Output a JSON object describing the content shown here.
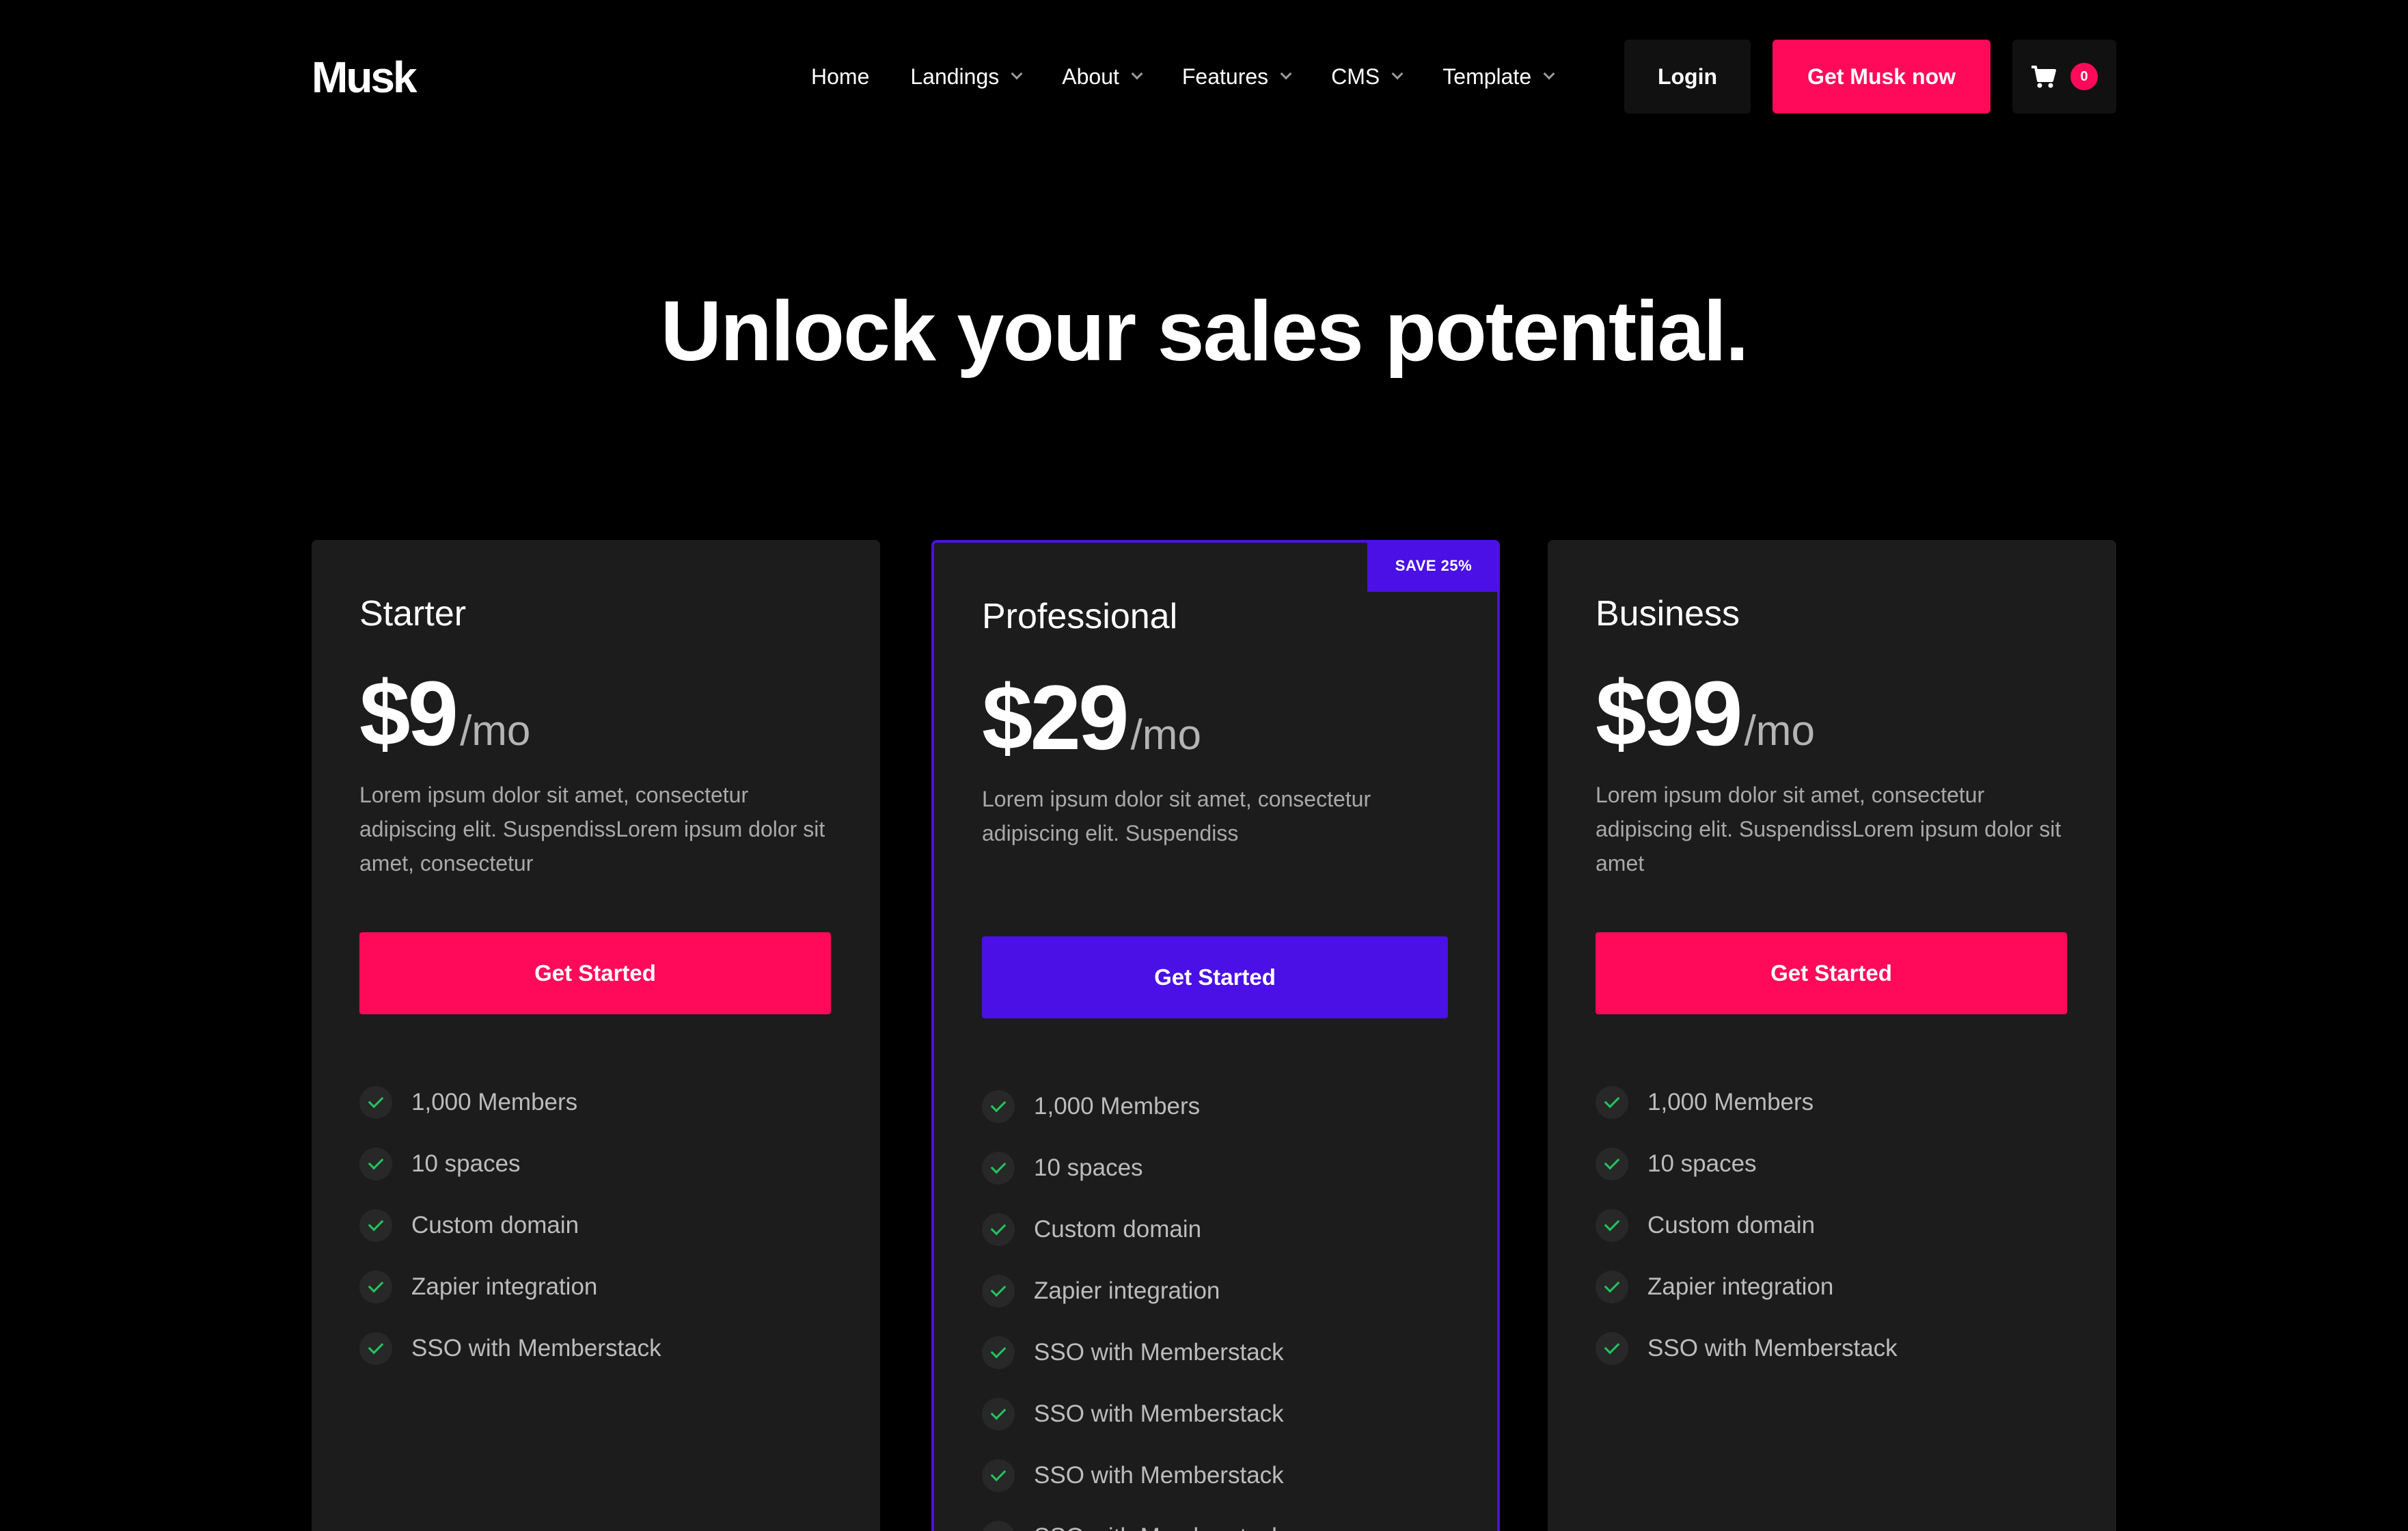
{
  "nav": {
    "logo": "Musk",
    "menu": [
      {
        "label": "Home",
        "dropdown": false
      },
      {
        "label": "Landings",
        "dropdown": true
      },
      {
        "label": "About",
        "dropdown": true
      },
      {
        "label": "Features",
        "dropdown": true
      },
      {
        "label": "CMS",
        "dropdown": true
      },
      {
        "label": "Template",
        "dropdown": true
      }
    ],
    "login_label": "Login",
    "cta_label": "Get Musk now",
    "cart_count": "0"
  },
  "hero": {
    "title": "Unlock your sales potential."
  },
  "colors": {
    "accent_pink": "#ff0a5b",
    "accent_purple": "#4a10e6",
    "check_green": "#22c55e",
    "card_bg": "#1c1c1c"
  },
  "plans": [
    {
      "name": "Starter",
      "price": "$9",
      "period": "/mo",
      "description": "Lorem ipsum dolor sit amet, consectetur adipiscing elit. SuspendissLorem ipsum dolor sit amet, consectetur",
      "button_label": "Get Started",
      "features": [
        "1,000 Members",
        "10 spaces",
        "Custom domain",
        "Zapier integration",
        "SSO with Memberstack"
      ]
    },
    {
      "name": "Professional",
      "price": "$29",
      "period": "/mo",
      "badge": "SAVE 25%",
      "description": "Lorem ipsum dolor sit amet, consectetur adipiscing elit. Suspendiss",
      "button_label": "Get Started",
      "features": [
        "1,000 Members",
        "10 spaces",
        "Custom domain",
        "Zapier integration",
        "SSO with Memberstack",
        "SSO with Memberstack",
        "SSO with Memberstack",
        "SSO with Memberstack"
      ]
    },
    {
      "name": "Business",
      "price": "$99",
      "period": "/mo",
      "description": "Lorem ipsum dolor sit amet, consectetur adipiscing elit. SuspendissLorem ipsum dolor sit amet",
      "button_label": "Get Started",
      "features": [
        "1,000 Members",
        "10 spaces",
        "Custom domain",
        "Zapier integration",
        "SSO with Memberstack"
      ]
    }
  ]
}
